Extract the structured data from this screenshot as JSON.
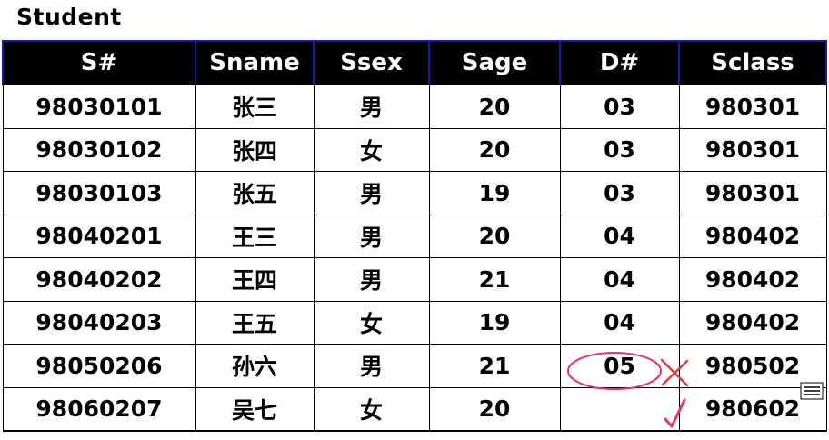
{
  "title": "Student",
  "columns": [
    "S#",
    "Sname",
    "Ssex",
    "Sage",
    "D#",
    "Sclass"
  ],
  "rows": [
    [
      "98030101",
      "张三",
      "男",
      "20",
      "03",
      "980301"
    ],
    [
      "98030102",
      "张四",
      "女",
      "20",
      "03",
      "980301"
    ],
    [
      "98030103",
      "张五",
      "男",
      "19",
      "03",
      "980301"
    ],
    [
      "98040201",
      "王三",
      "男",
      "20",
      "04",
      "980402"
    ],
    [
      "98040202",
      "王四",
      "男",
      "21",
      "04",
      "980402"
    ],
    [
      "98040203",
      "王五",
      "女",
      "19",
      "04",
      "980402"
    ],
    [
      "98050206",
      "孙六",
      "男",
      "21",
      "05",
      "980502"
    ],
    [
      "98060207",
      "吴七",
      "女",
      "20",
      "",
      "980602"
    ]
  ],
  "annotations": {
    "circle_color": "#e8336e",
    "cross_color": "#e53935",
    "check_color": "#e8336e"
  }
}
